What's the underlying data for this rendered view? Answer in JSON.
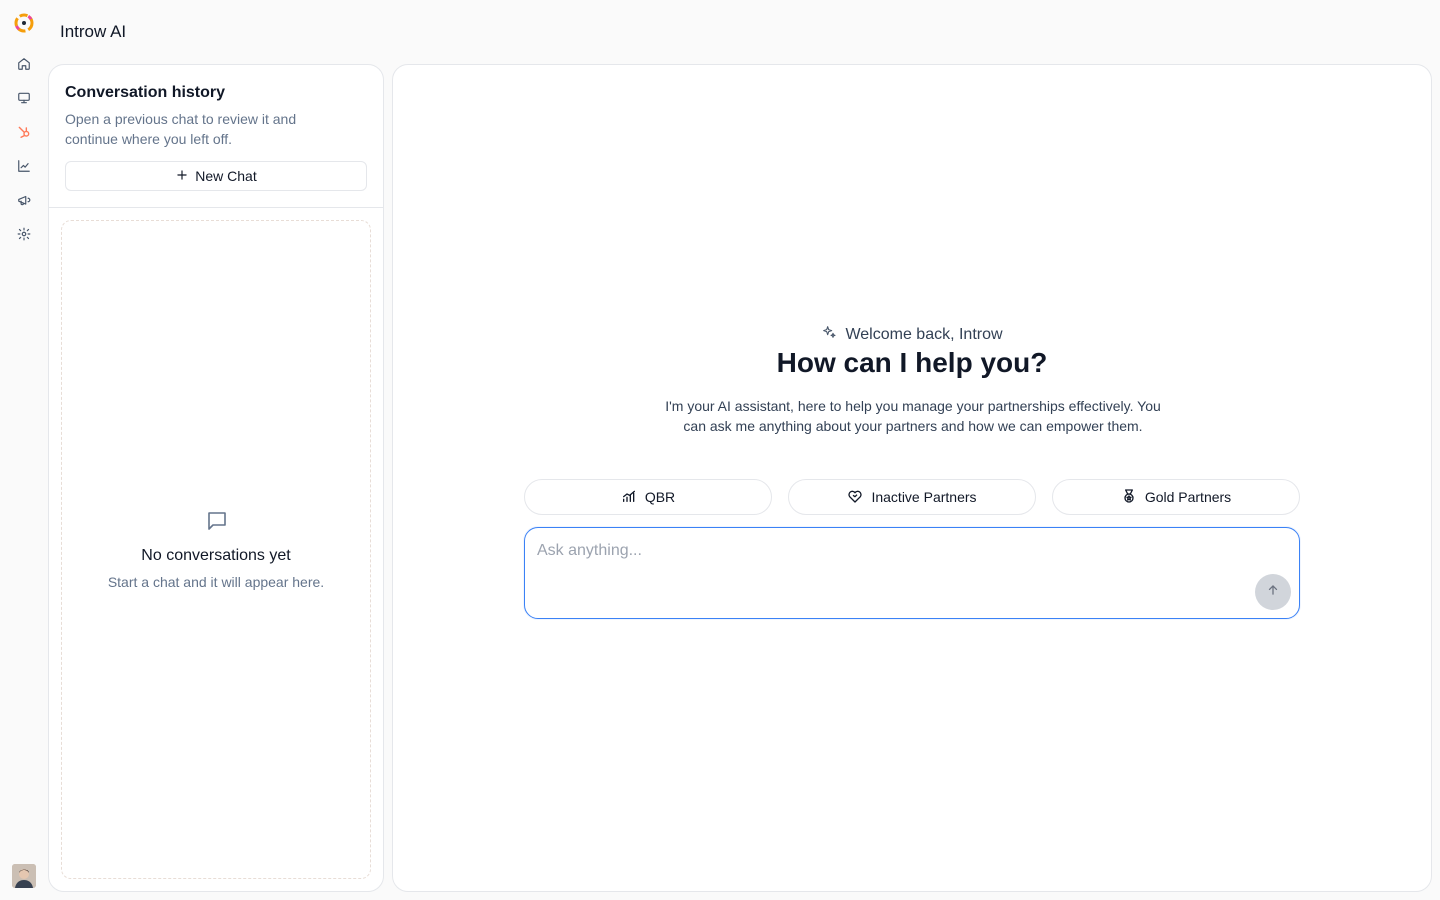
{
  "app": {
    "title": "Introw AI"
  },
  "rail": {
    "items": [
      {
        "name": "home-icon"
      },
      {
        "name": "monitor-icon"
      },
      {
        "name": "hubspot-icon"
      },
      {
        "name": "chart-line-icon"
      },
      {
        "name": "megaphone-icon"
      },
      {
        "name": "gear-icon"
      }
    ],
    "accent": "#ff7a59"
  },
  "history": {
    "title": "Conversation history",
    "subtitle": "Open a previous chat to review it and continue where you left off.",
    "new_chat_label": "New Chat",
    "empty_title": "No conversations yet",
    "empty_subtitle": "Start a chat and it will appear here."
  },
  "main": {
    "welcome": "Welcome back, Introw",
    "headline": "How can I help you?",
    "intro": "I'm your AI assistant, here to help you manage your partnerships effectively. You can ask me anything about your partners and how we can empower them.",
    "suggestions": [
      {
        "label": "QBR",
        "icon": "chart-bars-icon"
      },
      {
        "label": "Inactive Partners",
        "icon": "heart-handshake-icon"
      },
      {
        "label": "Gold Partners",
        "icon": "medal-icon"
      }
    ],
    "composer_placeholder": "Ask anything...",
    "focus_color": "#3b82f6"
  }
}
